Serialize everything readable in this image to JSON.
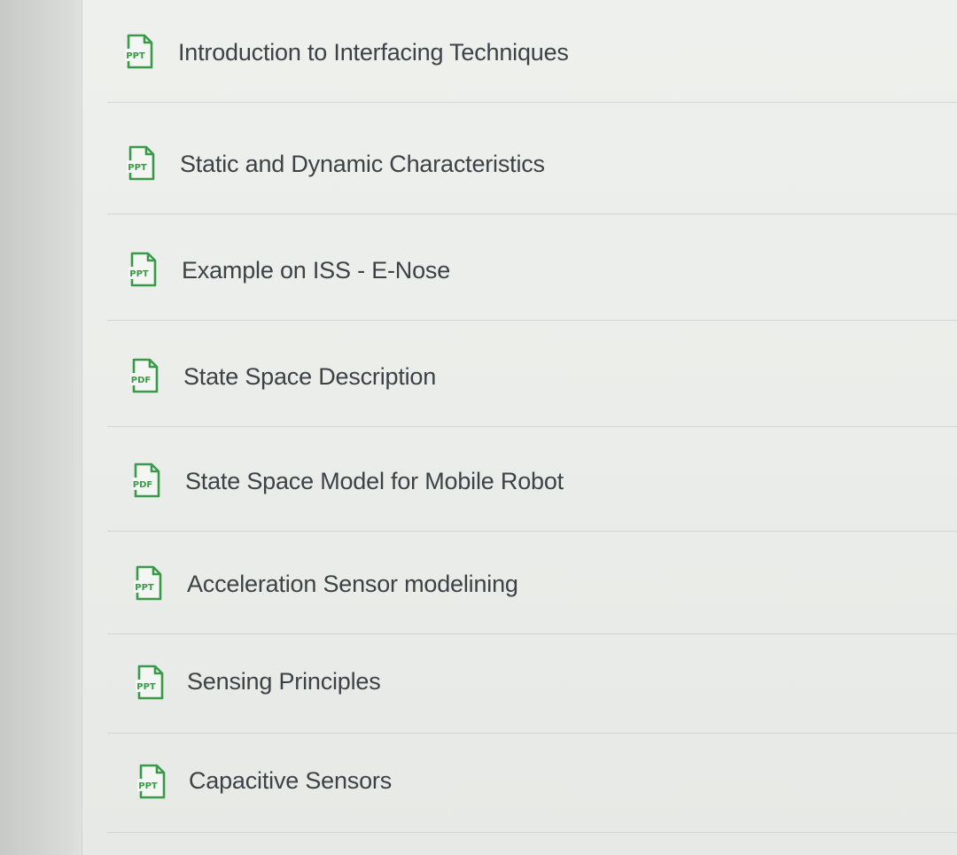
{
  "materials": [
    {
      "type_label": "PPT",
      "title": "Introduction to Interfacing Techniques"
    },
    {
      "type_label": "PPT",
      "title": "Static and Dynamic Characteristics"
    },
    {
      "type_label": "PPT",
      "title": "Example on ISS - E-Nose"
    },
    {
      "type_label": "PDF",
      "title": "State Space Description"
    },
    {
      "type_label": "PDF",
      "title": "State Space Model for Mobile Robot"
    },
    {
      "type_label": "PPT",
      "title": "Acceleration Sensor modelining"
    },
    {
      "type_label": "PPT",
      "title": "Sensing Principles"
    },
    {
      "type_label": "PPT",
      "title": "Capacitive Sensors"
    }
  ],
  "colors": {
    "icon_green": "#3a9a4a",
    "text": "#3c4246"
  },
  "icons": {
    "file": "file-icon"
  }
}
